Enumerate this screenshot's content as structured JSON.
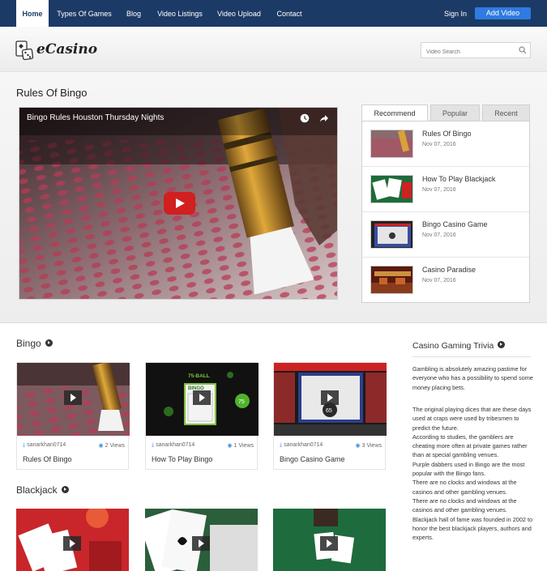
{
  "nav": {
    "items": [
      {
        "label": "Home"
      },
      {
        "label": "Types Of Games"
      },
      {
        "label": "Blog"
      },
      {
        "label": "Video Listings"
      },
      {
        "label": "Video Upload"
      },
      {
        "label": "Contact"
      }
    ],
    "sign_in": "Sign In",
    "add_video": "Add Video"
  },
  "header": {
    "logo_text": "eCasino",
    "search_placeholder": "Video Search"
  },
  "hero": {
    "title": "Rules Of Bingo",
    "video_title": "Bingo Rules Houston Thursday Nights"
  },
  "tabs": [
    "Recommend",
    "Popular",
    "Recent"
  ],
  "recommend": [
    {
      "title": "Rules Of Bingo",
      "date": "Nov 07, 2016"
    },
    {
      "title": "How To Play Blackjack",
      "date": "Nov 07, 2016"
    },
    {
      "title": "Bingo Casino Game",
      "date": "Nov 07, 2016"
    },
    {
      "title": "Casino Paradise",
      "date": "Nov 07, 2016"
    }
  ],
  "sections": {
    "bingo": {
      "title": "Bingo",
      "cards": [
        {
          "author": "sanarkhan0714",
          "views": "2 Views",
          "title": "Rules Of Bingo"
        },
        {
          "author": "sanarkhan0714",
          "views": "1 Views",
          "title": "How To Play Bingo"
        },
        {
          "author": "sanarkhan0714",
          "views": "3 Views",
          "title": "Bingo Casino Game"
        }
      ]
    },
    "blackjack": {
      "title": "Blackjack"
    }
  },
  "bingo_thumb_text": {
    "ball_header": "75-BALL",
    "bingo_word": "BINGO",
    "ball_65": "65",
    "ball_75": "75"
  },
  "trivia": {
    "title": "Casino Gaming Trivia",
    "intro": "Gambling is absolutely amazing pastime for everyone who has a possibility to spend some money placing bets.",
    "body": [
      "The original playing dices that are these days used at craps were used by tribesmen to predict the future.",
      "According to studies, the gamblers are cheating more often at private games rather than at special gambling venues.",
      "Purple dabbers used in Bingo are the most popular with the Bingo fans.",
      "There are no clocks and windows at the casinos and other gambling venues.",
      "There are no clocks and windows at the casinos and other gambling venues.",
      "Blackjack hall of fame was founded in 2002 to honor the best blackjack players, authors and experts."
    ]
  },
  "colors": {
    "nav_bg": "#1c3a66",
    "button": "#2f7be0",
    "play_red": "#d21f1f"
  }
}
